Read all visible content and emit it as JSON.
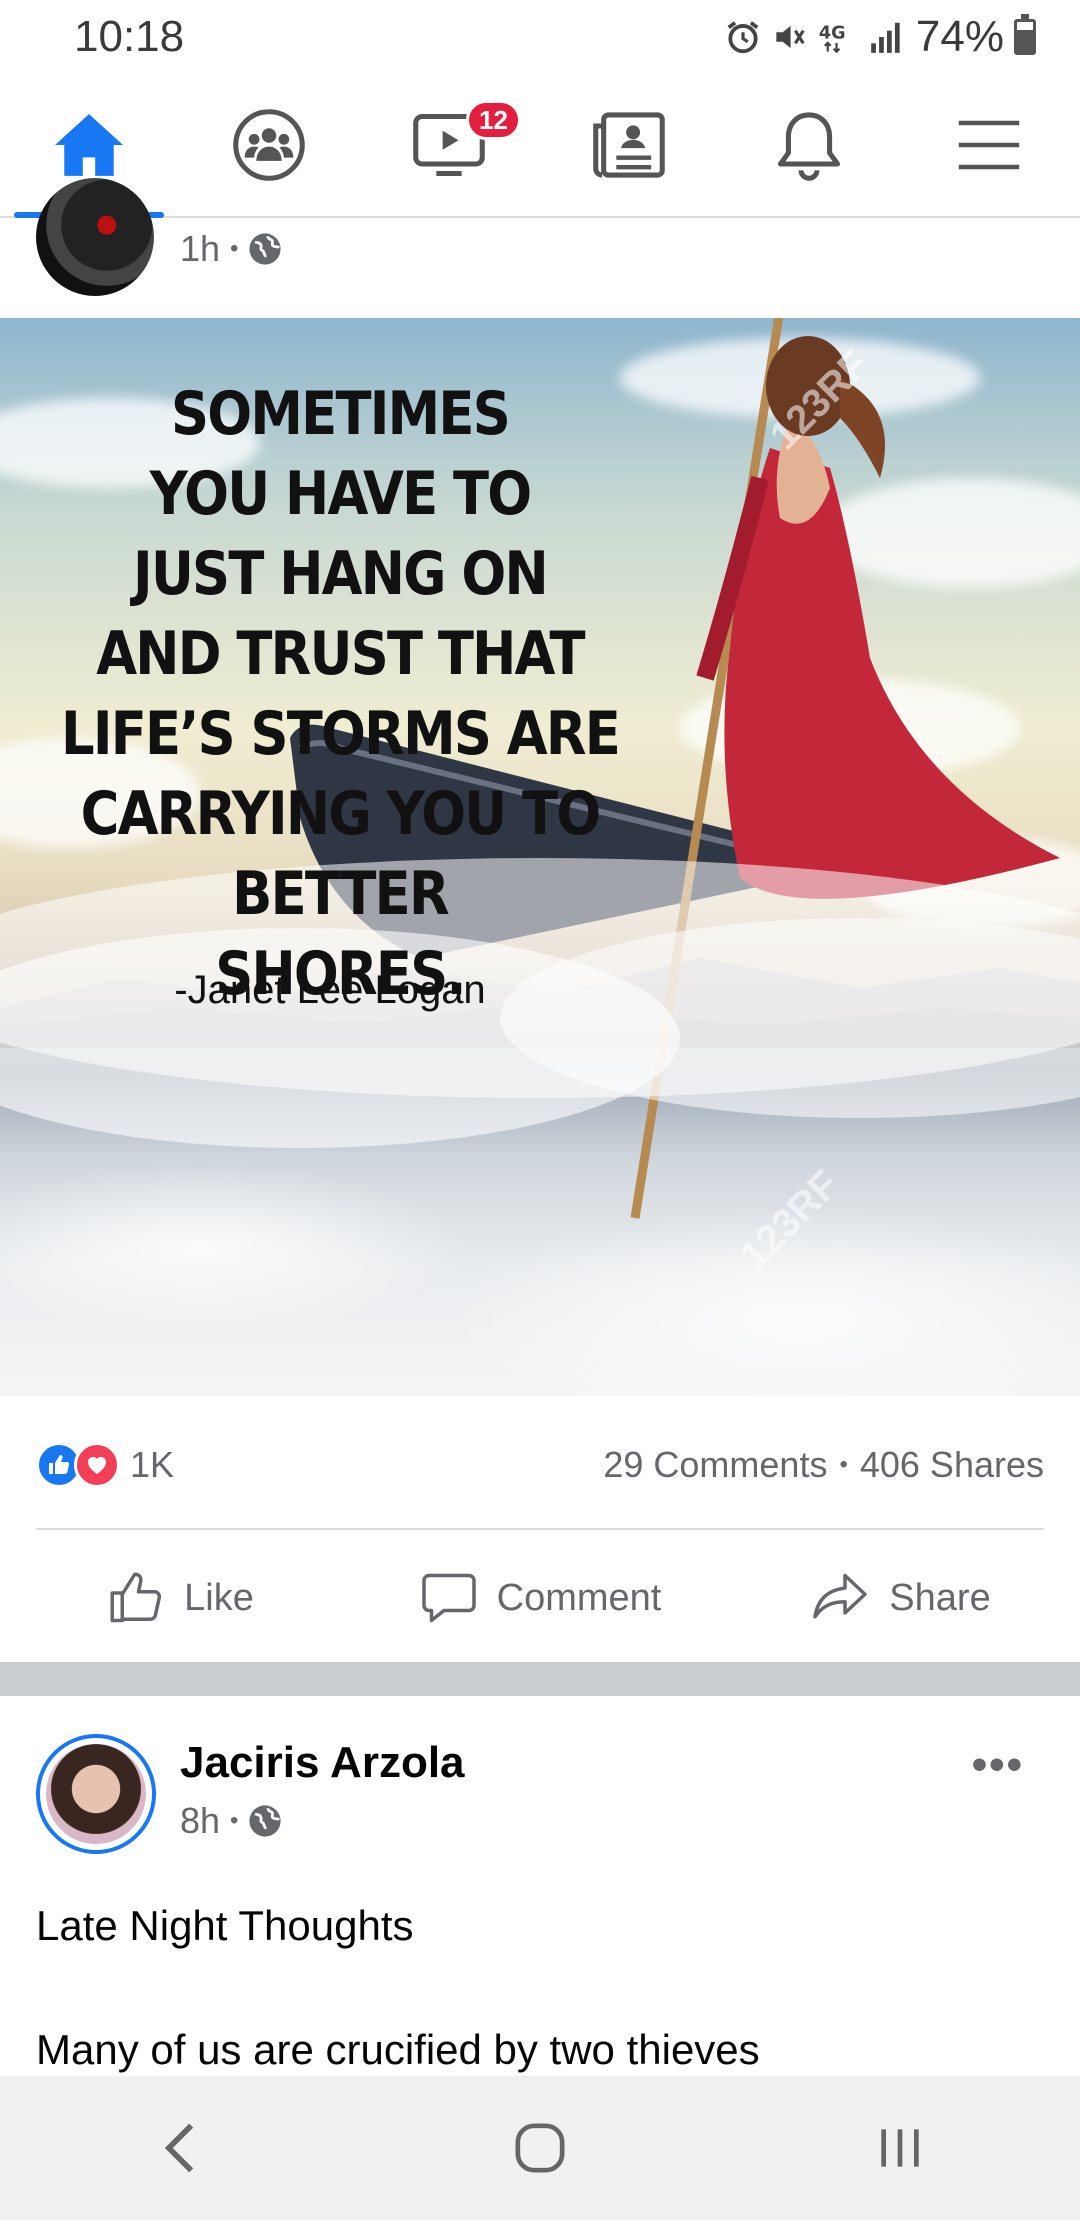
{
  "status_bar": {
    "time": "10:18",
    "battery": "74%",
    "icons": [
      "alarm-icon",
      "mute-icon",
      "lte-icon",
      "signal-icon",
      "battery-icon"
    ]
  },
  "nav": {
    "items": [
      {
        "name": "home",
        "icon": "home-icon",
        "active": true
      },
      {
        "name": "groups",
        "icon": "groups-icon"
      },
      {
        "name": "watch",
        "icon": "watch-icon",
        "badge": "12"
      },
      {
        "name": "news",
        "icon": "news-icon"
      },
      {
        "name": "notifications",
        "icon": "bell-icon"
      },
      {
        "name": "menu",
        "icon": "hamburger-icon"
      }
    ],
    "accent": "#1877f2"
  },
  "post1": {
    "time": "1h",
    "privacy_icon": "globe-icon",
    "image": {
      "quote_lines": [
        "SOMETIMES",
        "YOU HAVE TO",
        "JUST HANG ON",
        "AND TRUST THAT",
        "LIFE’S STORMS ARE",
        "CARRYING YOU TO BETTER",
        "SHORES."
      ],
      "author": "-Janet Lee Logan",
      "watermark": "123RF"
    },
    "reactions": {
      "count": "1K",
      "comments": "29 Comments",
      "shares": "406 Shares"
    },
    "actions": {
      "like": "Like",
      "comment": "Comment",
      "share": "Share"
    }
  },
  "post2": {
    "author": "Jaciris Arzola",
    "time": "8h",
    "privacy_icon": "globe-icon",
    "text_line1": "Late Night Thoughts",
    "text_line2": "Many of us are crucified by two thieves"
  },
  "system_nav": {
    "back": "back-icon",
    "home": "home-circle-icon",
    "recents": "recents-icon"
  }
}
